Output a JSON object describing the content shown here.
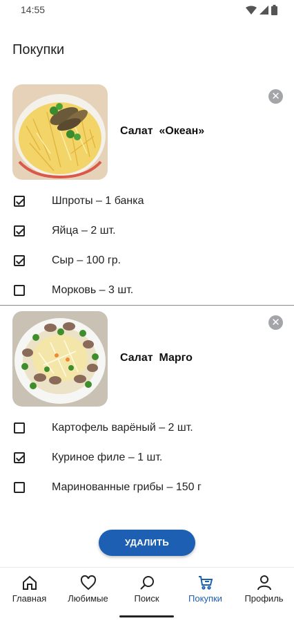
{
  "status": {
    "time": "14:55"
  },
  "page": {
    "title": "Покупки"
  },
  "recipes": [
    {
      "name": "Салат  «Океан»",
      "ingredients": [
        {
          "label": "Шпроты – 1 банка",
          "checked": true
        },
        {
          "label": "Яйца – 2 шт.",
          "checked": true
        },
        {
          "label": "Сыр – 100 гр.",
          "checked": true
        },
        {
          "label": "Морковь – 3 шт.",
          "checked": false
        }
      ]
    },
    {
      "name": "Салат  Марго",
      "ingredients": [
        {
          "label": "Картофель варёный – 2 шт.",
          "checked": false
        },
        {
          "label": "Куриное филе – 1 шт.",
          "checked": true
        },
        {
          "label": "Маринованные грибы – 150 г",
          "checked": false
        }
      ]
    }
  ],
  "actions": {
    "delete_label": "УДАЛИТЬ"
  },
  "nav": {
    "items": [
      {
        "label": "Главная",
        "icon": "home-icon"
      },
      {
        "label": "Любимые",
        "icon": "heart-icon"
      },
      {
        "label": "Поиск",
        "icon": "search-icon"
      },
      {
        "label": "Покупки",
        "icon": "cart-icon",
        "active": true
      },
      {
        "label": "Профиль",
        "icon": "person-icon"
      }
    ]
  },
  "colors": {
    "accent": "#1d5fb3",
    "remove": "#a3a5a8"
  }
}
